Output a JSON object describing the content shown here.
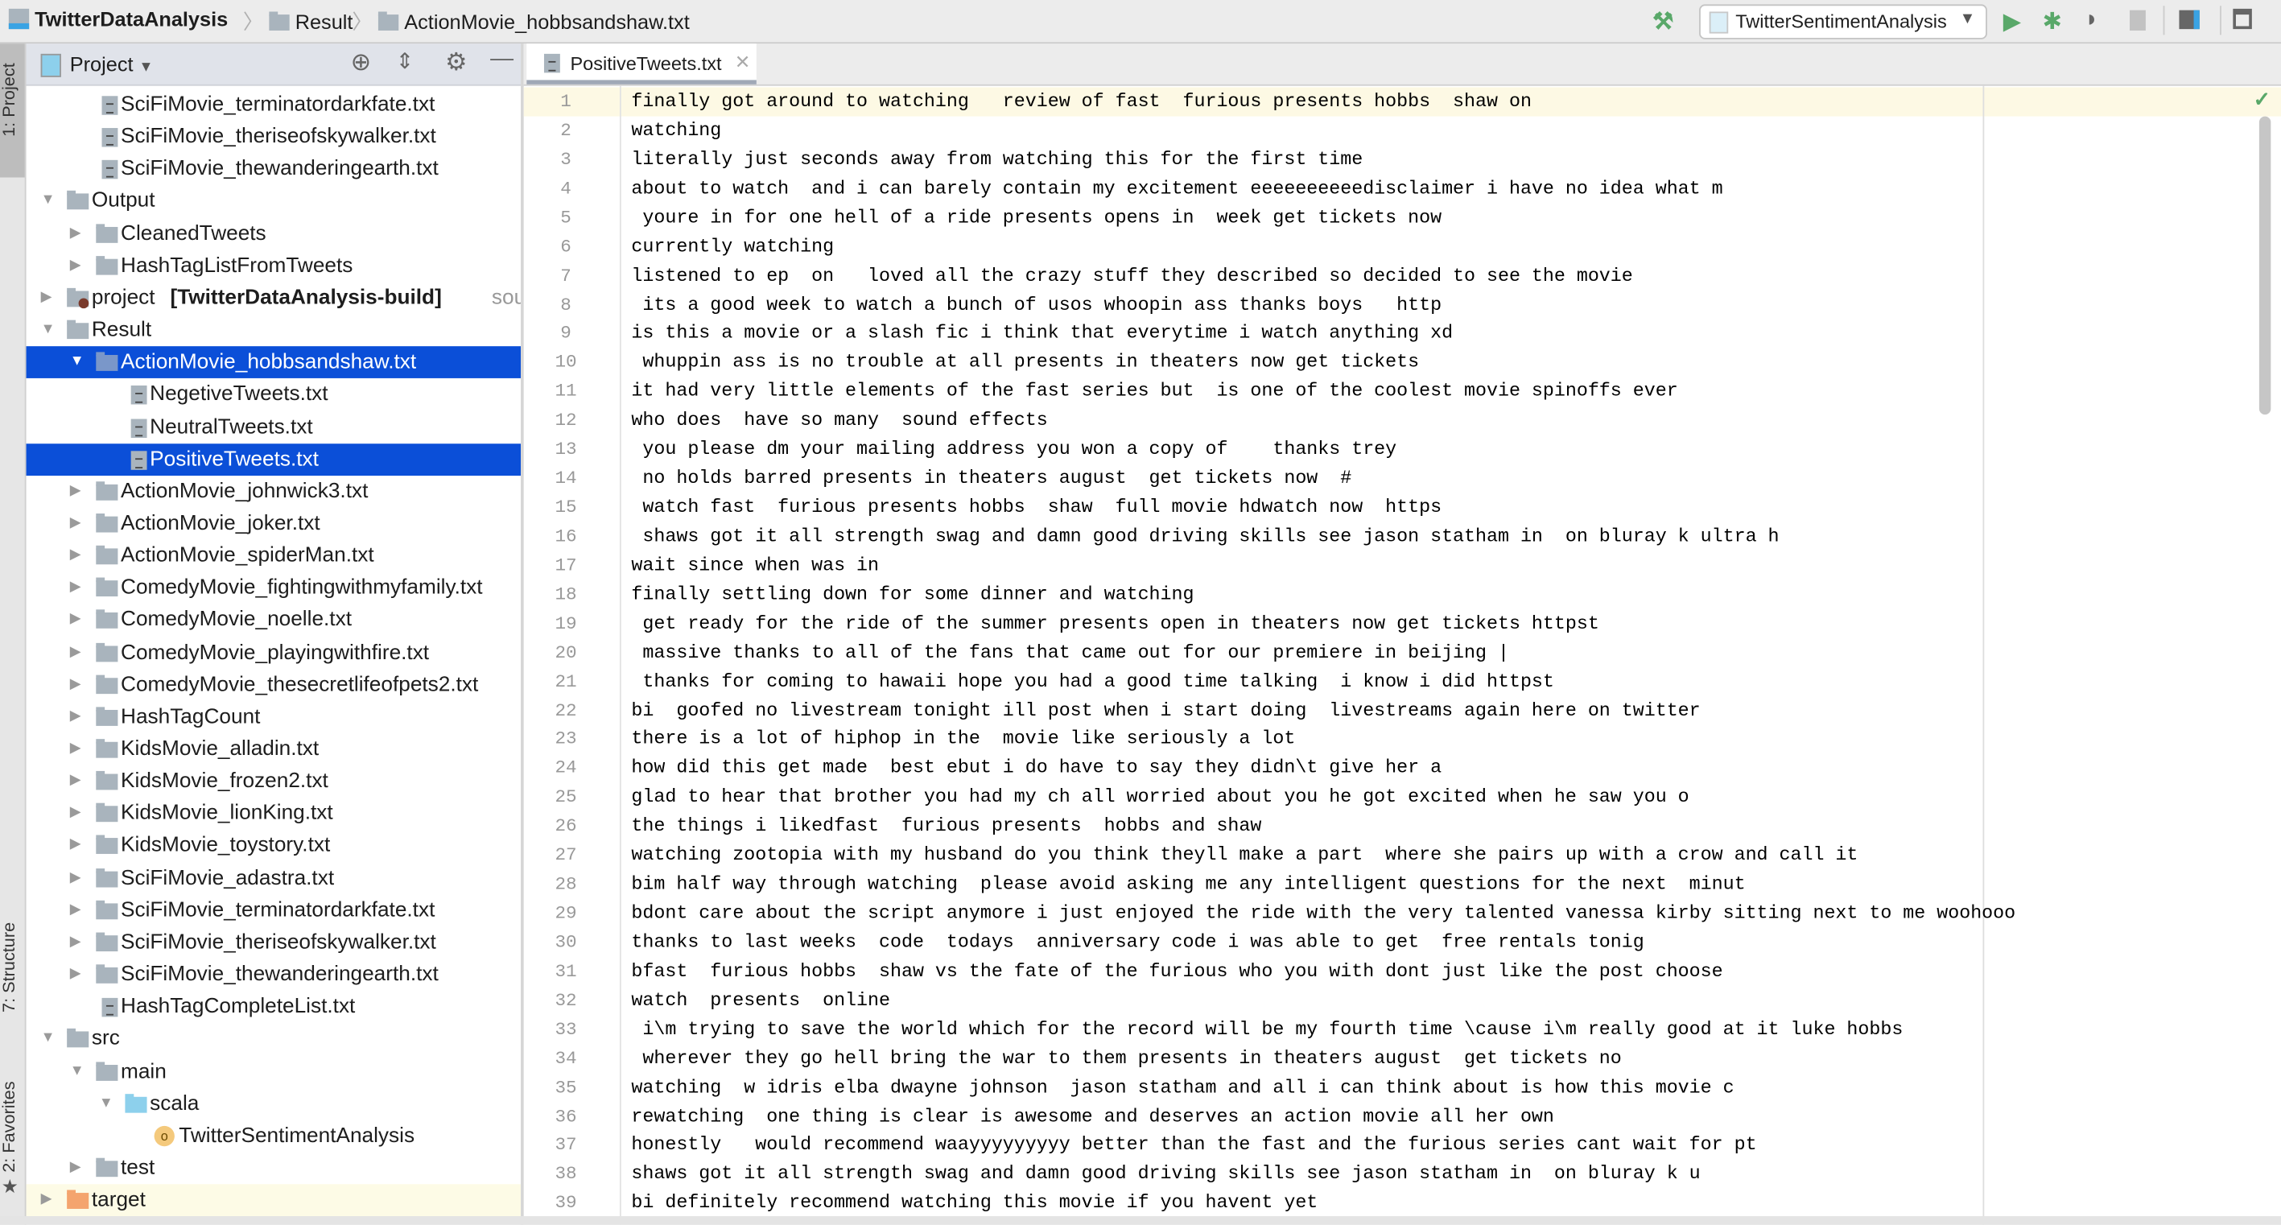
{
  "breadcrumb": {
    "project": "TwitterDataAnalysis",
    "folder": "Result",
    "file": "ActionMovie_hobbsandshaw.txt"
  },
  "toolbar": {
    "run_config": "TwitterSentimentAnalysis"
  },
  "side_tabs": {
    "project": "1: Project",
    "structure": "7: Structure",
    "favorites": "2: Favorites"
  },
  "project_panel": {
    "title": "Project"
  },
  "tree": [
    {
      "label": "SciFiMovie_terminatordarkfate.txt",
      "level": 1,
      "type": "file"
    },
    {
      "label": "SciFiMovie_theriseofskywalker.txt",
      "level": 1,
      "type": "file"
    },
    {
      "label": "SciFiMovie_thewanderingearth.txt",
      "level": 1,
      "type": "file"
    },
    {
      "label": "Output",
      "level": 0,
      "type": "folder",
      "state": "open"
    },
    {
      "label": "CleanedTweets",
      "level": 1,
      "type": "folder",
      "state": "closed"
    },
    {
      "label": "HashTagListFromTweets",
      "level": 1,
      "type": "folder",
      "state": "closed"
    },
    {
      "label": "project",
      "bold": "[TwitterDataAnalysis-build]",
      "hint": "sour",
      "level": 0,
      "type": "module",
      "state": "closed"
    },
    {
      "label": "Result",
      "level": 0,
      "type": "folder",
      "state": "open"
    },
    {
      "label": "ActionMovie_hobbsandshaw.txt",
      "level": 1,
      "type": "folder",
      "state": "open",
      "selected": true
    },
    {
      "label": "NegetiveTweets.txt",
      "level": 2,
      "type": "file"
    },
    {
      "label": "NeutralTweets.txt",
      "level": 2,
      "type": "file"
    },
    {
      "label": "PositiveTweets.txt",
      "level": 2,
      "type": "file",
      "selected": true
    },
    {
      "label": "ActionMovie_johnwick3.txt",
      "level": 1,
      "type": "folder",
      "state": "closed"
    },
    {
      "label": "ActionMovie_joker.txt",
      "level": 1,
      "type": "folder",
      "state": "closed"
    },
    {
      "label": "ActionMovie_spiderMan.txt",
      "level": 1,
      "type": "folder",
      "state": "closed"
    },
    {
      "label": "ComedyMovie_fightingwithmyfamily.txt",
      "level": 1,
      "type": "folder",
      "state": "closed"
    },
    {
      "label": "ComedyMovie_noelle.txt",
      "level": 1,
      "type": "folder",
      "state": "closed"
    },
    {
      "label": "ComedyMovie_playingwithfire.txt",
      "level": 1,
      "type": "folder",
      "state": "closed"
    },
    {
      "label": "ComedyMovie_thesecretlifeofpets2.txt",
      "level": 1,
      "type": "folder",
      "state": "closed"
    },
    {
      "label": "HashTagCount",
      "level": 1,
      "type": "folder",
      "state": "closed"
    },
    {
      "label": "KidsMovie_alladin.txt",
      "level": 1,
      "type": "folder",
      "state": "closed"
    },
    {
      "label": "KidsMovie_frozen2.txt",
      "level": 1,
      "type": "folder",
      "state": "closed"
    },
    {
      "label": "KidsMovie_lionKing.txt",
      "level": 1,
      "type": "folder",
      "state": "closed"
    },
    {
      "label": "KidsMovie_toystory.txt",
      "level": 1,
      "type": "folder",
      "state": "closed"
    },
    {
      "label": "SciFiMovie_adastra.txt",
      "level": 1,
      "type": "folder",
      "state": "closed"
    },
    {
      "label": "SciFiMovie_terminatordarkfate.txt",
      "level": 1,
      "type": "folder",
      "state": "closed"
    },
    {
      "label": "SciFiMovie_theriseofskywalker.txt",
      "level": 1,
      "type": "folder",
      "state": "closed"
    },
    {
      "label": "SciFiMovie_thewanderingearth.txt",
      "level": 1,
      "type": "folder",
      "state": "closed"
    },
    {
      "label": "HashTagCompleteList.txt",
      "level": 1,
      "type": "file"
    },
    {
      "label": "src",
      "level": 0,
      "type": "folder",
      "state": "open"
    },
    {
      "label": "main",
      "level": 1,
      "type": "folder",
      "state": "open"
    },
    {
      "label": "scala",
      "level": 2,
      "type": "folder",
      "state": "open",
      "color": "#8dd0ec"
    },
    {
      "label": "TwitterSentimentAnalysis",
      "level": 3,
      "type": "object"
    },
    {
      "label": "test",
      "level": 1,
      "type": "folder",
      "state": "closed"
    },
    {
      "label": "target",
      "level": 0,
      "type": "folder",
      "state": "closed",
      "color": "#f4a46e",
      "highlight": true
    }
  ],
  "editor": {
    "tab_label": "PositiveTweets.txt",
    "lines": [
      "finally got around to watching   review of fast  furious presents hobbs  shaw on",
      "watching",
      "literally just seconds away from watching this for the first time",
      "about to watch  and i can barely contain my excitement eeeeeeeeeedisclaimer i have no idea what m",
      " youre in for one hell of a ride presents opens in  week get tickets now",
      "currently watching",
      "listened to ep  on   loved all the crazy stuff they described so decided to see the movie",
      " its a good week to watch a bunch of usos whoopin ass thanks boys   http",
      "is this a movie or a slash fic i think that everytime i watch anything xd",
      " whuppin ass is no trouble at all presents in theaters now get tickets",
      "it had very little elements of the fast series but  is one of the coolest movie spinoffs ever",
      "who does  have so many  sound effects",
      " you please dm your mailing address you won a copy of    thanks trey",
      " no holds barred presents in theaters august  get tickets now  #",
      " watch fast  furious presents hobbs  shaw  full movie hdwatch now  https",
      " shaws got it all strength swag and damn good driving skills see jason statham in  on bluray k ultra h",
      "wait since when was in",
      "finally settling down for some dinner and watching",
      " get ready for the ride of the summer presents open in theaters now get tickets httpst",
      " massive thanks to all of the fans that came out for our premiere in beijing |",
      " thanks for coming to hawaii hope you had a good time talking  i know i did httpst",
      "bi  goofed no livestream tonight ill post when i start doing  livestreams again here on twitter",
      "there is a lot of hiphop in the  movie like seriously a lot",
      "how did this get made  best ebut i do have to say they didn\\t give her a",
      "glad to hear that brother you had my ch all worried about you he got excited when he saw you o",
      "the things i likedfast  furious presents  hobbs and shaw",
      "watching zootopia with my husband do you think theyll make a part  where she pairs up with a crow and call it",
      "bim half way through watching  please avoid asking me any intelligent questions for the next  minut",
      "bdont care about the script anymore i just enjoyed the ride with the very talented vanessa kirby sitting next to me woohooo",
      "thanks to last weeks  code  todays  anniversary code i was able to get  free rentals tonig",
      "bfast  furious hobbs  shaw vs the fate of the furious who you with dont just like the post choose",
      "watch  presents  online",
      " i\\m trying to save the world which for the record will be my fourth time \\cause i\\m really good at it luke hobbs",
      " wherever they go hell bring the war to them presents in theaters august  get tickets no",
      "watching  w idris elba dwayne johnson  jason statham and all i can think about is how this movie c",
      "rewatching  one thing is clear is awesome and deserves an action movie all her own",
      "honestly   would recommend waayyyyyyyyy better than the fast and the furious series cant wait for pt",
      "shaws got it all strength swag and damn good driving skills see jason statham in  on bluray k u",
      "bi definitely recommend watching this movie if you havent yet"
    ]
  },
  "colors": {
    "selection": "#0b4fd8",
    "run": "#59a869",
    "current_line": "#fdf9e4"
  }
}
